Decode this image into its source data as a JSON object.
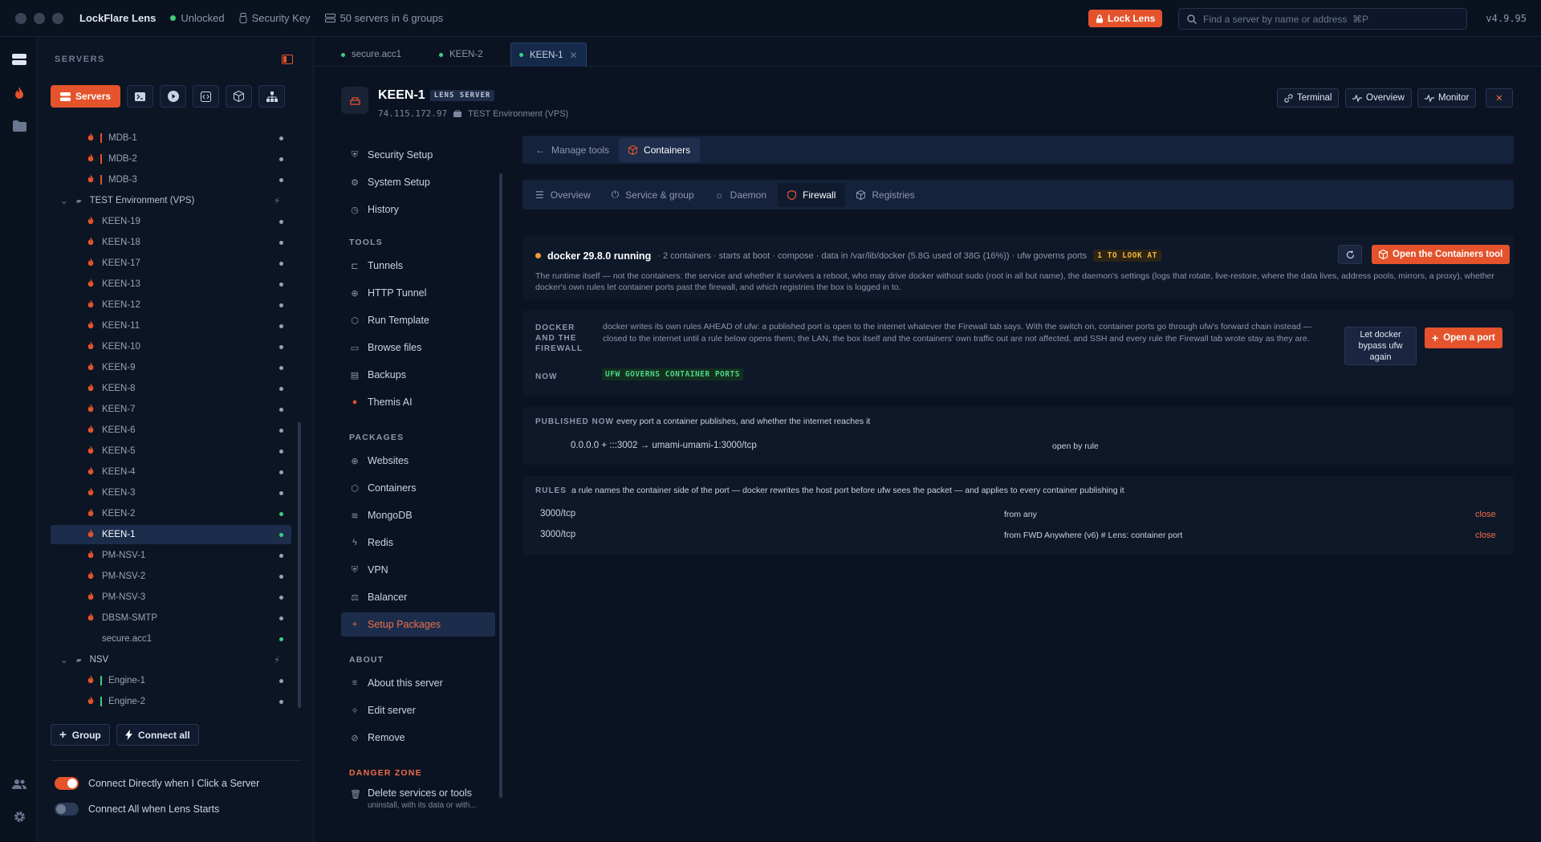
{
  "titlebar": {
    "app_name": "LockFlare Lens",
    "status": "Unlocked",
    "security_key": "Security Key",
    "servers_count": "50 servers in 6 groups",
    "lock_button": "Lock Lens",
    "search_placeholder": "Find a server by name or address  ⌘P",
    "version": "v4.9.95"
  },
  "sidebar": {
    "title": "SERVERS",
    "servers_button": "Servers",
    "tree": [
      {
        "label": "MDB-1",
        "kind": "server",
        "bar": "#e4532b",
        "indent": 2,
        "online": false
      },
      {
        "label": "MDB-2",
        "kind": "server",
        "bar": "#e4532b",
        "indent": 2,
        "online": false
      },
      {
        "label": "MDB-3",
        "kind": "server",
        "bar": "#e4532b",
        "indent": 2,
        "online": false
      },
      {
        "label": "TEST Environment (VPS)",
        "kind": "group"
      },
      {
        "label": "KEEN-19",
        "kind": "server",
        "online": false
      },
      {
        "label": "KEEN-18",
        "kind": "server",
        "online": false
      },
      {
        "label": "KEEN-17",
        "kind": "server",
        "online": false
      },
      {
        "label": "KEEN-13",
        "kind": "server",
        "online": false
      },
      {
        "label": "KEEN-12",
        "kind": "server",
        "online": false
      },
      {
        "label": "KEEN-11",
        "kind": "server",
        "online": false
      },
      {
        "label": "KEEN-10",
        "kind": "server",
        "online": false
      },
      {
        "label": "KEEN-9",
        "kind": "server",
        "online": false
      },
      {
        "label": "KEEN-8",
        "kind": "server",
        "online": false
      },
      {
        "label": "KEEN-7",
        "kind": "server",
        "online": false
      },
      {
        "label": "KEEN-6",
        "kind": "server",
        "online": false
      },
      {
        "label": "KEEN-5",
        "kind": "server",
        "online": false
      },
      {
        "label": "KEEN-4",
        "kind": "server",
        "online": false
      },
      {
        "label": "KEEN-3",
        "kind": "server",
        "online": false
      },
      {
        "label": "KEEN-2",
        "kind": "server",
        "online": true
      },
      {
        "label": "KEEN-1",
        "kind": "server",
        "online": true,
        "selected": true
      },
      {
        "label": "PM-NSV-1",
        "kind": "server",
        "online": false
      },
      {
        "label": "PM-NSV-2",
        "kind": "server",
        "online": false
      },
      {
        "label": "PM-NSV-3",
        "kind": "server",
        "online": false
      },
      {
        "label": "DBSM-SMTP",
        "kind": "server",
        "online": false
      },
      {
        "label": "secure.acc1",
        "kind": "server",
        "online": true,
        "noflame": true
      },
      {
        "label": "NSV",
        "kind": "group"
      },
      {
        "label": "Engine-1",
        "kind": "server",
        "bar": "#3ecf7d",
        "indent": 2,
        "online": false
      },
      {
        "label": "Engine-2",
        "kind": "server",
        "bar": "#3ecf7d",
        "indent": 2,
        "online": false
      }
    ],
    "group_button": "Group",
    "connect_all_button": "Connect all",
    "toggle_connect_direct": "Connect Directly when I Click a Server",
    "toggle_connect_all": "Connect All when Lens Starts"
  },
  "tabs": [
    {
      "label": "secure.acc1",
      "active": false
    },
    {
      "label": "KEEN-2",
      "active": false
    },
    {
      "label": "KEEN-1",
      "active": true
    }
  ],
  "server": {
    "name": "KEEN-1",
    "badge": "LENS SERVER",
    "ip": "74.115.172.97",
    "env": "TEST Environment (VPS)",
    "buttons": {
      "terminal": "Terminal",
      "overview": "Overview",
      "monitor": "Monitor"
    }
  },
  "nav": {
    "top": [
      "Security Setup",
      "System Setup",
      "History"
    ],
    "tools_head": "TOOLS",
    "tools": [
      "Tunnels",
      "HTTP Tunnel",
      "Run Template",
      "Browse files",
      "Backups",
      "Themis AI"
    ],
    "packages_head": "PACKAGES",
    "packages": [
      "Websites",
      "Containers",
      "MongoDB",
      "Redis",
      "VPN",
      "Balancer",
      "Setup Packages"
    ],
    "about_head": "ABOUT",
    "about": [
      "About this server",
      "Edit server",
      "Remove"
    ],
    "danger_head": "DANGER ZONE",
    "danger_item": "Delete services or tools",
    "danger_sub": "uninstall, with its data or with..."
  },
  "crumbs": {
    "back": "Manage tools",
    "current": "Containers"
  },
  "subtabs": [
    "Overview",
    "Service & group",
    "Daemon",
    "Firewall",
    "Registries"
  ],
  "runtime": {
    "title": "docker 29.8.0 running",
    "details": "· 2 containers · starts at boot · compose · data in /var/lib/docker (5.8G used of 38G (16%)) · ufw governs ports",
    "look_badge": "1 TO LOOK AT",
    "open_button": "Open the Containers tool",
    "description": "The runtime itself — not the containers: the service and whether it survives a reboot, who may drive docker without sudo (root in all but name), the daemon's settings (logs that rotate, live-restore, where the data lives, address pools, mirrors, a proxy), whether docker's own rules let container ports past the firewall, and which registries the box is logged in to."
  },
  "firewall": {
    "label": "DOCKER AND THE FIREWALL",
    "text": "docker writes its own rules AHEAD of ufw: a published port is open to the internet whatever the Firewall tab says. With the switch on, container ports go through ufw's forward chain instead — closed to the internet until a rule below opens them; the LAN, the box itself and the containers' own traffic out are not affected, and SSH and every rule the Firewall tab wrote stay as they are.",
    "now_label": "NOW",
    "now_value": "UFW GOVERNS CONTAINER PORTS",
    "bypass_button": "Let docker bypass ufw again",
    "open_port_button": "Open a port"
  },
  "published": {
    "label": "PUBLISHED NOW",
    "hint": "every port a container publishes, and whether the internet reaches it",
    "rows": [
      {
        "mapping": "0.0.0.0 + :::3002 → umami-umami-1:3000/tcp",
        "state": "open by rule"
      }
    ]
  },
  "rules": {
    "label": "RULES",
    "hint": "a rule names the container side of the port — docker rewrites the host port before ufw sees the packet — and applies to every container publishing it",
    "rows": [
      {
        "port": "3000/tcp",
        "from": "from any",
        "action": "close"
      },
      {
        "port": "3000/tcp",
        "from": "from FWD Anywhere (v6) # Lens: container port",
        "action": "close"
      }
    ]
  },
  "colors": {
    "accent": "#e4532b",
    "ok": "#3ecf7d",
    "warn": "#f3b43b"
  }
}
